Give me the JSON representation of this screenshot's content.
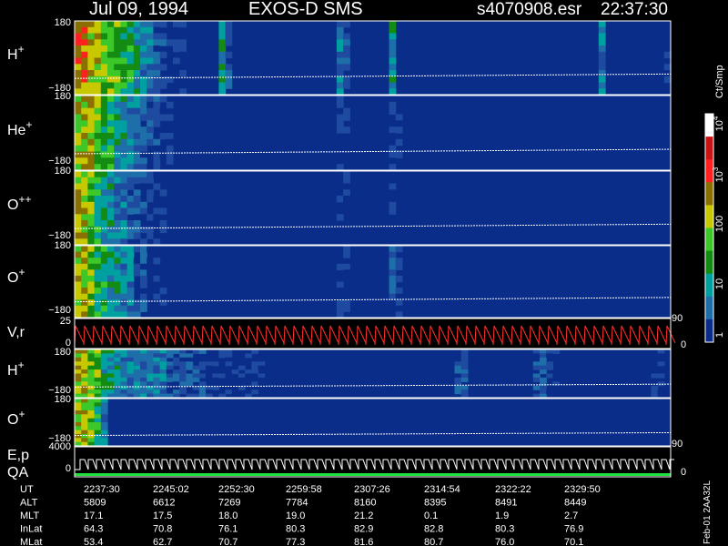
{
  "header": {
    "date": "Jul 09, 1994",
    "instrument": "EXOS-D SMS",
    "file": "s4070908.esr",
    "time": "22:37:30"
  },
  "panels": [
    {
      "id": "h_plus",
      "label": "H",
      "sup": "+",
      "top": "180",
      "bottom": "−180"
    },
    {
      "id": "he_plus",
      "label": "He",
      "sup": "+",
      "top": "180",
      "bottom": "−180"
    },
    {
      "id": "o_pp",
      "label": "O",
      "sup": "++",
      "top": "180",
      "bottom": "−180"
    },
    {
      "id": "o_plus",
      "label": "O",
      "sup": "+",
      "top": "180",
      "bottom": "−180"
    },
    {
      "id": "vr",
      "label": "V,r",
      "sup": "",
      "top": "25",
      "bottom": "0"
    },
    {
      "id": "h_plus_2",
      "label": "H",
      "sup": "+",
      "top": "180",
      "bottom": "−180"
    },
    {
      "id": "o_plus_2",
      "label": "O",
      "sup": "+",
      "top": "180",
      "bottom": "−180"
    },
    {
      "id": "ep",
      "label": "E,p",
      "sup": "",
      "top": "4000",
      "bottom": "0"
    },
    {
      "id": "qa",
      "label": "QA",
      "sup": "",
      "top": "",
      "bottom": ""
    }
  ],
  "right_axis": {
    "r1": "90",
    "r2": "0",
    "r3": "90",
    "r4": "0"
  },
  "colorbar": {
    "unit": "Ct/Smp",
    "ticks": [
      {
        "base": "10",
        "exp": "4"
      },
      {
        "base": "10",
        "exp": "3"
      },
      {
        "base": "100",
        "exp": ""
      },
      {
        "base": "10",
        "exp": ""
      },
      {
        "base": "1",
        "exp": ""
      }
    ],
    "colors": [
      "#ffffff",
      "#c81414",
      "#ff2020",
      "#8a7000",
      "#c8c800",
      "#3cc828",
      "#148c14",
      "#00a0a0",
      "#1e6eaa",
      "#0a2d8a"
    ]
  },
  "footer_rows": [
    {
      "label": "UT",
      "values": [
        "2237:30",
        "2245:02",
        "2252:30",
        "2259:58",
        "2307:26",
        "2314:54",
        "2322:22",
        "2329:50"
      ]
    },
    {
      "label": "ALT",
      "values": [
        "5809",
        "6612",
        "7269",
        "7784",
        "8160",
        "8395",
        "8491",
        "8449"
      ]
    },
    {
      "label": "MLT",
      "values": [
        "17.1",
        "17.5",
        "18.0",
        "19.0",
        "21.2",
        "0.1",
        "1.9",
        "2.7"
      ]
    },
    {
      "label": "InLat",
      "values": [
        "64.3",
        "70.8",
        "76.1",
        "80.3",
        "82.9",
        "82.8",
        "80.3",
        "76.9"
      ]
    },
    {
      "label": "MLat",
      "values": [
        "53.4",
        "62.7",
        "70.7",
        "77.3",
        "81.6",
        "80.7",
        "76.0",
        "70.1"
      ]
    }
  ],
  "side_note": "Feb-01 2AA32L",
  "chart_data": {
    "type": "heatmap",
    "title": "Jul 09, 1994   EXOS-D SMS",
    "x_tick_labels": [
      "2237:30",
      "2245:02",
      "2252:30",
      "2259:58",
      "2307:26",
      "2314:54",
      "2322:22",
      "2329:50"
    ],
    "pitch_angle_range": [
      -180,
      180
    ],
    "vr_range": [
      0,
      25
    ],
    "energy_range": [
      0,
      4000
    ],
    "colorbar_range": [
      1,
      10000
    ],
    "colorbar_scale": "log",
    "colorbar_unit": "Ct/Smp",
    "series": [
      {
        "name": "H+",
        "activity": [
          9,
          9,
          8,
          8,
          7,
          7,
          7,
          6,
          6,
          5,
          4,
          4,
          3,
          3,
          2,
          2,
          2,
          1,
          1,
          1,
          1,
          1,
          5,
          3,
          1,
          1,
          1,
          1,
          1,
          1,
          1,
          1,
          1,
          1,
          1,
          1,
          1,
          1,
          1,
          1,
          4,
          3,
          1,
          1,
          1,
          1,
          1,
          1,
          5,
          1,
          1,
          1,
          1,
          1,
          1,
          1,
          1,
          1,
          1,
          1,
          1,
          1,
          1,
          1,
          1,
          1,
          1,
          1,
          1,
          1,
          1,
          1,
          1,
          1,
          1,
          1,
          1,
          1,
          1,
          1,
          4,
          1,
          1,
          1,
          1,
          1,
          1,
          1,
          1,
          1,
          2
        ]
      },
      {
        "name": "He+",
        "activity": [
          8,
          8,
          8,
          7,
          6,
          6,
          5,
          5,
          4,
          4,
          3,
          3,
          3,
          2,
          2,
          1,
          1,
          1,
          1,
          1,
          1,
          1,
          1,
          1,
          1,
          1,
          1,
          1,
          1,
          1,
          1,
          1,
          1,
          1,
          1,
          1,
          1,
          1,
          1,
          1,
          2,
          2,
          1,
          1,
          1,
          1,
          1,
          1,
          2,
          2,
          1,
          1,
          1,
          1,
          1,
          1,
          1,
          1,
          1,
          1,
          1,
          1,
          1,
          1,
          1,
          1,
          1,
          1,
          1,
          1,
          1,
          1,
          1,
          1,
          1,
          1,
          1,
          1,
          1,
          1,
          1,
          1,
          1,
          1,
          1,
          1,
          1,
          1,
          1,
          1,
          1
        ]
      },
      {
        "name": "O++",
        "activity": [
          8,
          8,
          7,
          6,
          5,
          5,
          4,
          4,
          3,
          3,
          3,
          2,
          2,
          2,
          1,
          1,
          1,
          1,
          1,
          1,
          1,
          1,
          1,
          1,
          1,
          1,
          1,
          1,
          1,
          1,
          1,
          1,
          1,
          1,
          1,
          1,
          1,
          1,
          1,
          1,
          2,
          2,
          1,
          1,
          1,
          1,
          1,
          1,
          2,
          1,
          1,
          1,
          1,
          1,
          1,
          1,
          1,
          1,
          1,
          1,
          1,
          1,
          1,
          1,
          1,
          1,
          1,
          1,
          1,
          1,
          1,
          1,
          1,
          1,
          1,
          1,
          1,
          1,
          1,
          1,
          1,
          1,
          1,
          1,
          1,
          1,
          1,
          1,
          1,
          1,
          1
        ]
      },
      {
        "name": "O+",
        "activity": [
          8,
          8,
          7,
          6,
          6,
          5,
          5,
          4,
          4,
          3,
          3,
          2,
          2,
          2,
          1,
          1,
          1,
          1,
          1,
          1,
          1,
          1,
          1,
          1,
          1,
          1,
          1,
          1,
          1,
          1,
          1,
          1,
          1,
          1,
          1,
          1,
          1,
          1,
          1,
          1,
          2,
          2,
          1,
          1,
          1,
          1,
          1,
          1,
          3,
          2,
          1,
          1,
          1,
          1,
          1,
          1,
          1,
          1,
          1,
          1,
          1,
          1,
          1,
          1,
          1,
          1,
          1,
          1,
          1,
          1,
          1,
          1,
          1,
          1,
          1,
          1,
          1,
          1,
          1,
          1,
          1,
          1,
          1,
          1,
          1,
          1,
          1,
          1,
          1,
          1,
          1
        ]
      },
      {
        "name": "H+ (lower)",
        "activity": [
          8,
          8,
          7,
          7,
          5,
          5,
          5,
          4,
          4,
          4,
          4,
          4,
          4,
          4,
          3,
          3,
          3,
          3,
          3,
          3,
          2,
          2,
          2,
          2,
          2,
          2,
          2,
          2,
          2,
          1,
          1,
          1,
          1,
          1,
          1,
          1,
          1,
          1,
          1,
          1,
          1,
          1,
          1,
          1,
          1,
          1,
          1,
          1,
          1,
          1,
          1,
          1,
          1,
          1,
          1,
          1,
          1,
          1,
          3,
          3,
          1,
          1,
          1,
          1,
          1,
          1,
          1,
          1,
          1,
          1,
          3,
          3,
          2,
          2,
          1,
          1,
          1,
          1,
          1,
          1,
          1,
          1,
          1,
          1,
          1,
          1,
          1,
          1,
          2,
          2,
          1
        ]
      },
      {
        "name": "O+ (lower)",
        "activity": [
          8,
          8,
          7,
          6,
          4,
          1,
          1,
          1,
          1,
          1,
          1,
          1,
          1,
          1,
          1,
          1,
          1,
          1,
          1,
          1,
          1,
          1,
          1,
          1,
          1,
          1,
          1,
          1,
          1,
          1,
          1,
          1,
          1,
          1,
          1,
          1,
          1,
          1,
          1,
          1,
          1,
          1,
          1,
          1,
          1,
          1,
          1,
          1,
          1,
          1,
          1,
          1,
          1,
          1,
          1,
          1,
          1,
          1,
          1,
          1,
          1,
          1,
          1,
          1,
          1,
          1,
          1,
          1,
          1,
          1,
          1,
          1,
          1,
          1,
          1,
          1,
          1,
          1,
          1,
          1,
          1,
          1,
          1,
          1,
          1,
          1,
          1,
          1,
          1,
          1,
          1
        ]
      }
    ]
  }
}
